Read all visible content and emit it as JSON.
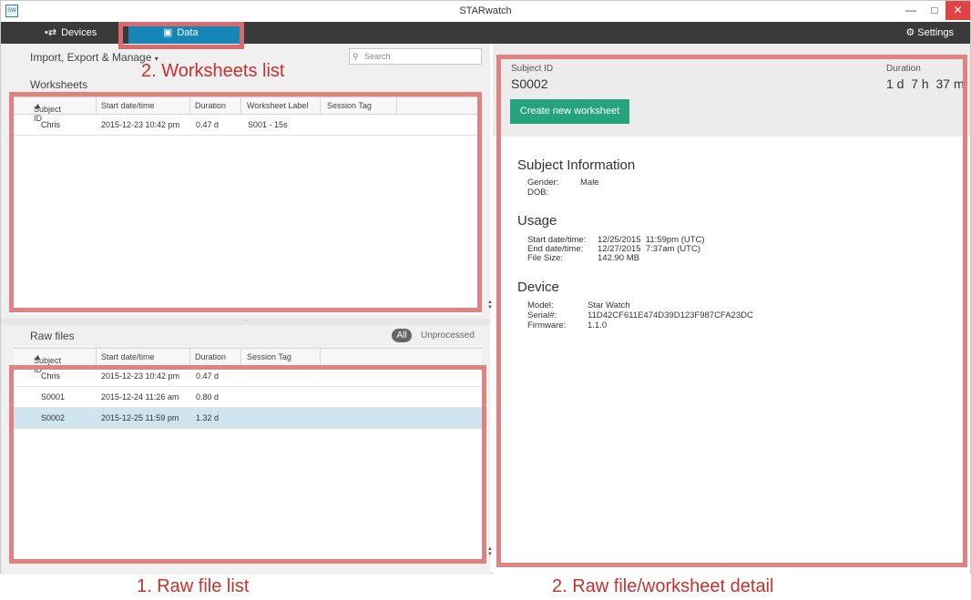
{
  "window": {
    "title": "STARwatch",
    "icon": "app-icon"
  },
  "nav": {
    "devices": {
      "label": "Devices",
      "icon": "usb-icon"
    },
    "data": {
      "label": "Data",
      "icon": "inbox-icon"
    },
    "settings": {
      "label": "Settings",
      "icon": "gear-icon"
    }
  },
  "left": {
    "menu_label": "Import, Export & Manage",
    "search_placeholder": "Search",
    "worksheets": {
      "title": "Worksheets",
      "columns": [
        "Subject ID",
        "Start date/time",
        "Duration",
        "Worksheet Label",
        "Session Tag"
      ],
      "rows": [
        [
          "Chris",
          "2015-12-23 10:42 pm",
          "0.47 d",
          "S001 - 15s",
          ""
        ]
      ]
    },
    "raw_files": {
      "title": "Raw files",
      "filter_all": "All",
      "filter_unprocessed": "Unprocessed",
      "columns": [
        "Subject ID",
        "Start date/time",
        "Duration",
        "Session Tag"
      ],
      "rows": [
        [
          "Chris",
          "2015-12-23 10:42 pm",
          "0.47 d",
          ""
        ],
        [
          "S0001",
          "2015-12-24 11:26 am",
          "0.80 d",
          ""
        ],
        [
          "S0002",
          "2015-12-25 11:59 pm",
          "1.32 d",
          ""
        ]
      ]
    }
  },
  "detail": {
    "subject_label": "Subject ID",
    "subject_value": "S0002",
    "duration_label": "Duration",
    "duration_value": "1 d  7 h  37 m",
    "create_button": "Create new worksheet",
    "subject_info": {
      "heading": "Subject Information",
      "gender_label": "Gender:",
      "gender_value": "Male",
      "dob_label": "DOB:",
      "dob_value": ""
    },
    "usage": {
      "heading": "Usage",
      "start_label": "Start date/time:",
      "start_value": "12/25/2015  11:59pm (UTC)",
      "end_label": "End date/time:",
      "end_value": "12/27/2015  7:37am (UTC)",
      "size_label": "File Size:",
      "size_value": "142.90 MB"
    },
    "device": {
      "heading": "Device",
      "model_label": "Model:",
      "model_value": "Star Watch",
      "serial_label": "Serial#:",
      "serial_value": "11D42CF611E474D39D123F987CFA23DC",
      "firmware_label": "Firmware:",
      "firmware_value": "1.1.0"
    }
  },
  "annotations": {
    "worksheets_list": "2. Worksheets list",
    "raw_file_list": "1. Raw file list",
    "detail": "2. Raw file/worksheet detail"
  },
  "colors": {
    "nav_bg": "#3a3a3a",
    "active_tab": "#1586b7",
    "create_button": "#24a37d",
    "selected_row": "#cfe6f0",
    "annotation": "#e08282",
    "annotation_text": "#c8302c"
  }
}
